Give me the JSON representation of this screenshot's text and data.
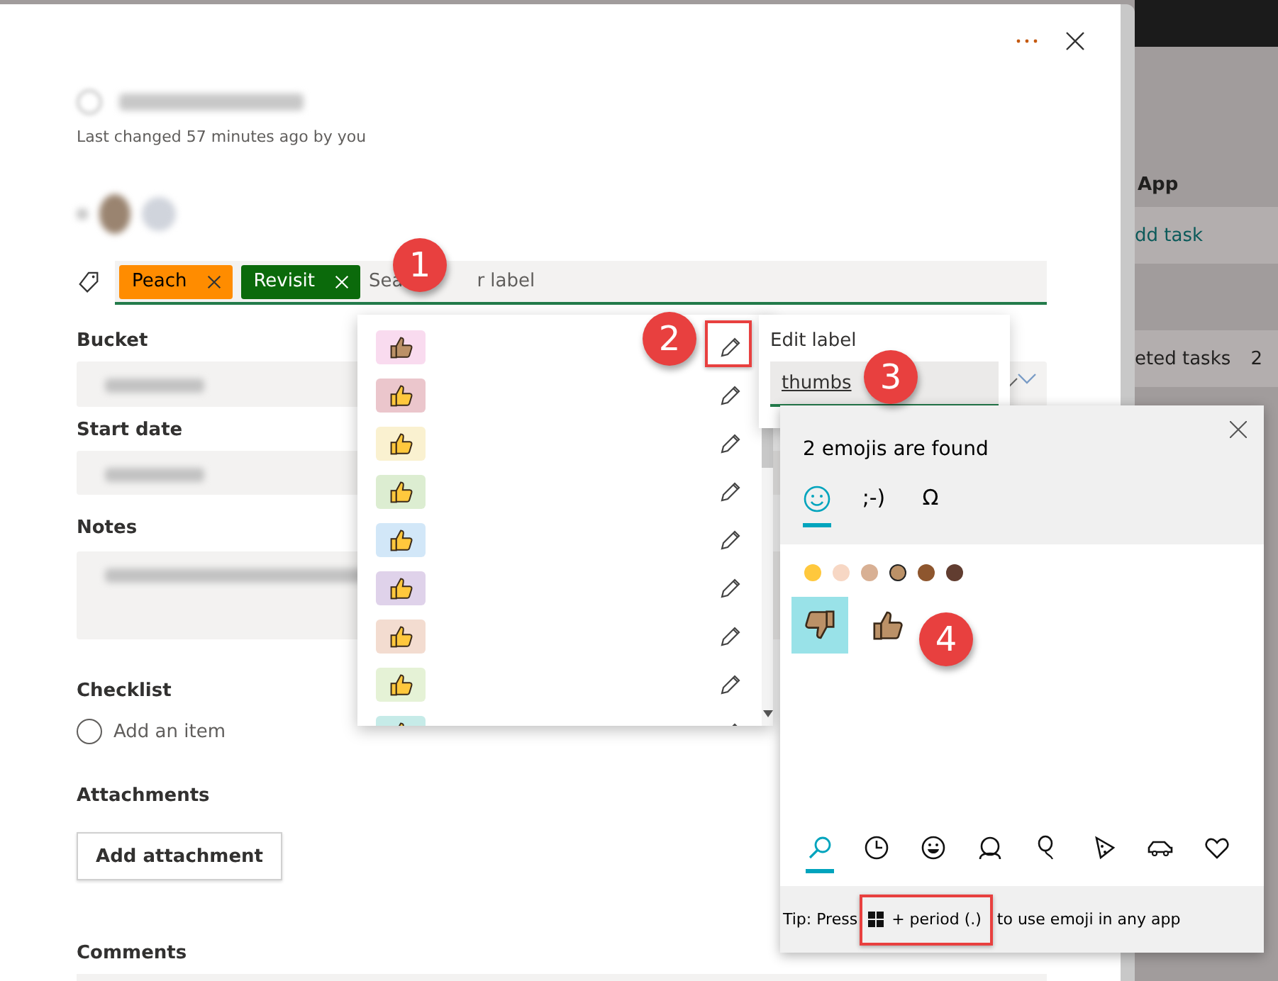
{
  "task": {
    "last_changed": "Last changed 57 minutes ago by you"
  },
  "labels": {
    "chips": [
      {
        "text": "Peach",
        "color": "#ff8c00"
      },
      {
        "text": "Revisit",
        "color": "#0b6a0b"
      }
    ],
    "placeholder_start": "Sea",
    "placeholder_end": "r label"
  },
  "fields": [
    {
      "label": "Bucket",
      "kind": "dropdown"
    },
    {
      "label": "Start date",
      "kind": "date"
    },
    {
      "label": "Notes",
      "kind": "textarea"
    }
  ],
  "checklist": {
    "heading": "Checklist",
    "placeholder": "Add an item"
  },
  "attachments": {
    "heading": "Attachments",
    "button": "Add attachment"
  },
  "comments": {
    "heading": "Comments"
  },
  "label_picker": {
    "items": [
      {
        "color": "#f9dbef",
        "kind": "medium"
      },
      {
        "color": "#ebc6cc",
        "kind": "default"
      },
      {
        "color": "#faf1d0",
        "kind": "default"
      },
      {
        "color": "#dcedd1",
        "kind": "default"
      },
      {
        "color": "#d2e7f8",
        "kind": "default"
      },
      {
        "color": "#dfd2ea",
        "kind": "default"
      },
      {
        "color": "#f3dcd0",
        "kind": "default"
      },
      {
        "color": "#e5f2d6",
        "kind": "default"
      },
      {
        "color": "#c6ebe8",
        "kind": "default"
      }
    ]
  },
  "edit_label": {
    "title": "Edit label",
    "value": "thumbs"
  },
  "emoji_panel": {
    "heading": "2 emojis are found",
    "tabs": [
      {
        "kind": "emoji",
        "selected": true
      },
      {
        "kind": "text",
        "label": ";-)",
        "selected": false
      },
      {
        "kind": "text",
        "label": "Ω",
        "selected": false
      }
    ],
    "skin_tones": [
      {
        "color": "#ffc83d",
        "selected": false
      },
      {
        "color": "#f7d7c4",
        "selected": false
      },
      {
        "color": "#d8b094",
        "selected": false
      },
      {
        "color": "#bb9167",
        "selected": true
      },
      {
        "color": "#8e562e",
        "selected": false
      },
      {
        "color": "#613d30",
        "selected": false
      }
    ],
    "results": [
      {
        "kind": "thumbs-down",
        "selected": true
      },
      {
        "kind": "thumbs-up",
        "selected": false
      }
    ],
    "categories": [
      {
        "kind": "search",
        "selected": true
      },
      {
        "kind": "clock",
        "selected": false
      },
      {
        "kind": "smiley",
        "selected": false
      },
      {
        "kind": "person",
        "selected": false
      },
      {
        "kind": "balloon",
        "selected": false
      },
      {
        "kind": "pizza",
        "selected": false
      },
      {
        "kind": "car",
        "selected": false
      },
      {
        "kind": "heart",
        "selected": false
      }
    ],
    "tip_start": "Tip: Press",
    "tip_key": "+ period (.)",
    "tip_end": "to use emoji in any app"
  },
  "background": {
    "title": "App",
    "add_task": "dd task",
    "completed": "eted tasks",
    "completed_count": "2"
  },
  "callouts": [
    "1",
    "2",
    "3",
    "4"
  ]
}
